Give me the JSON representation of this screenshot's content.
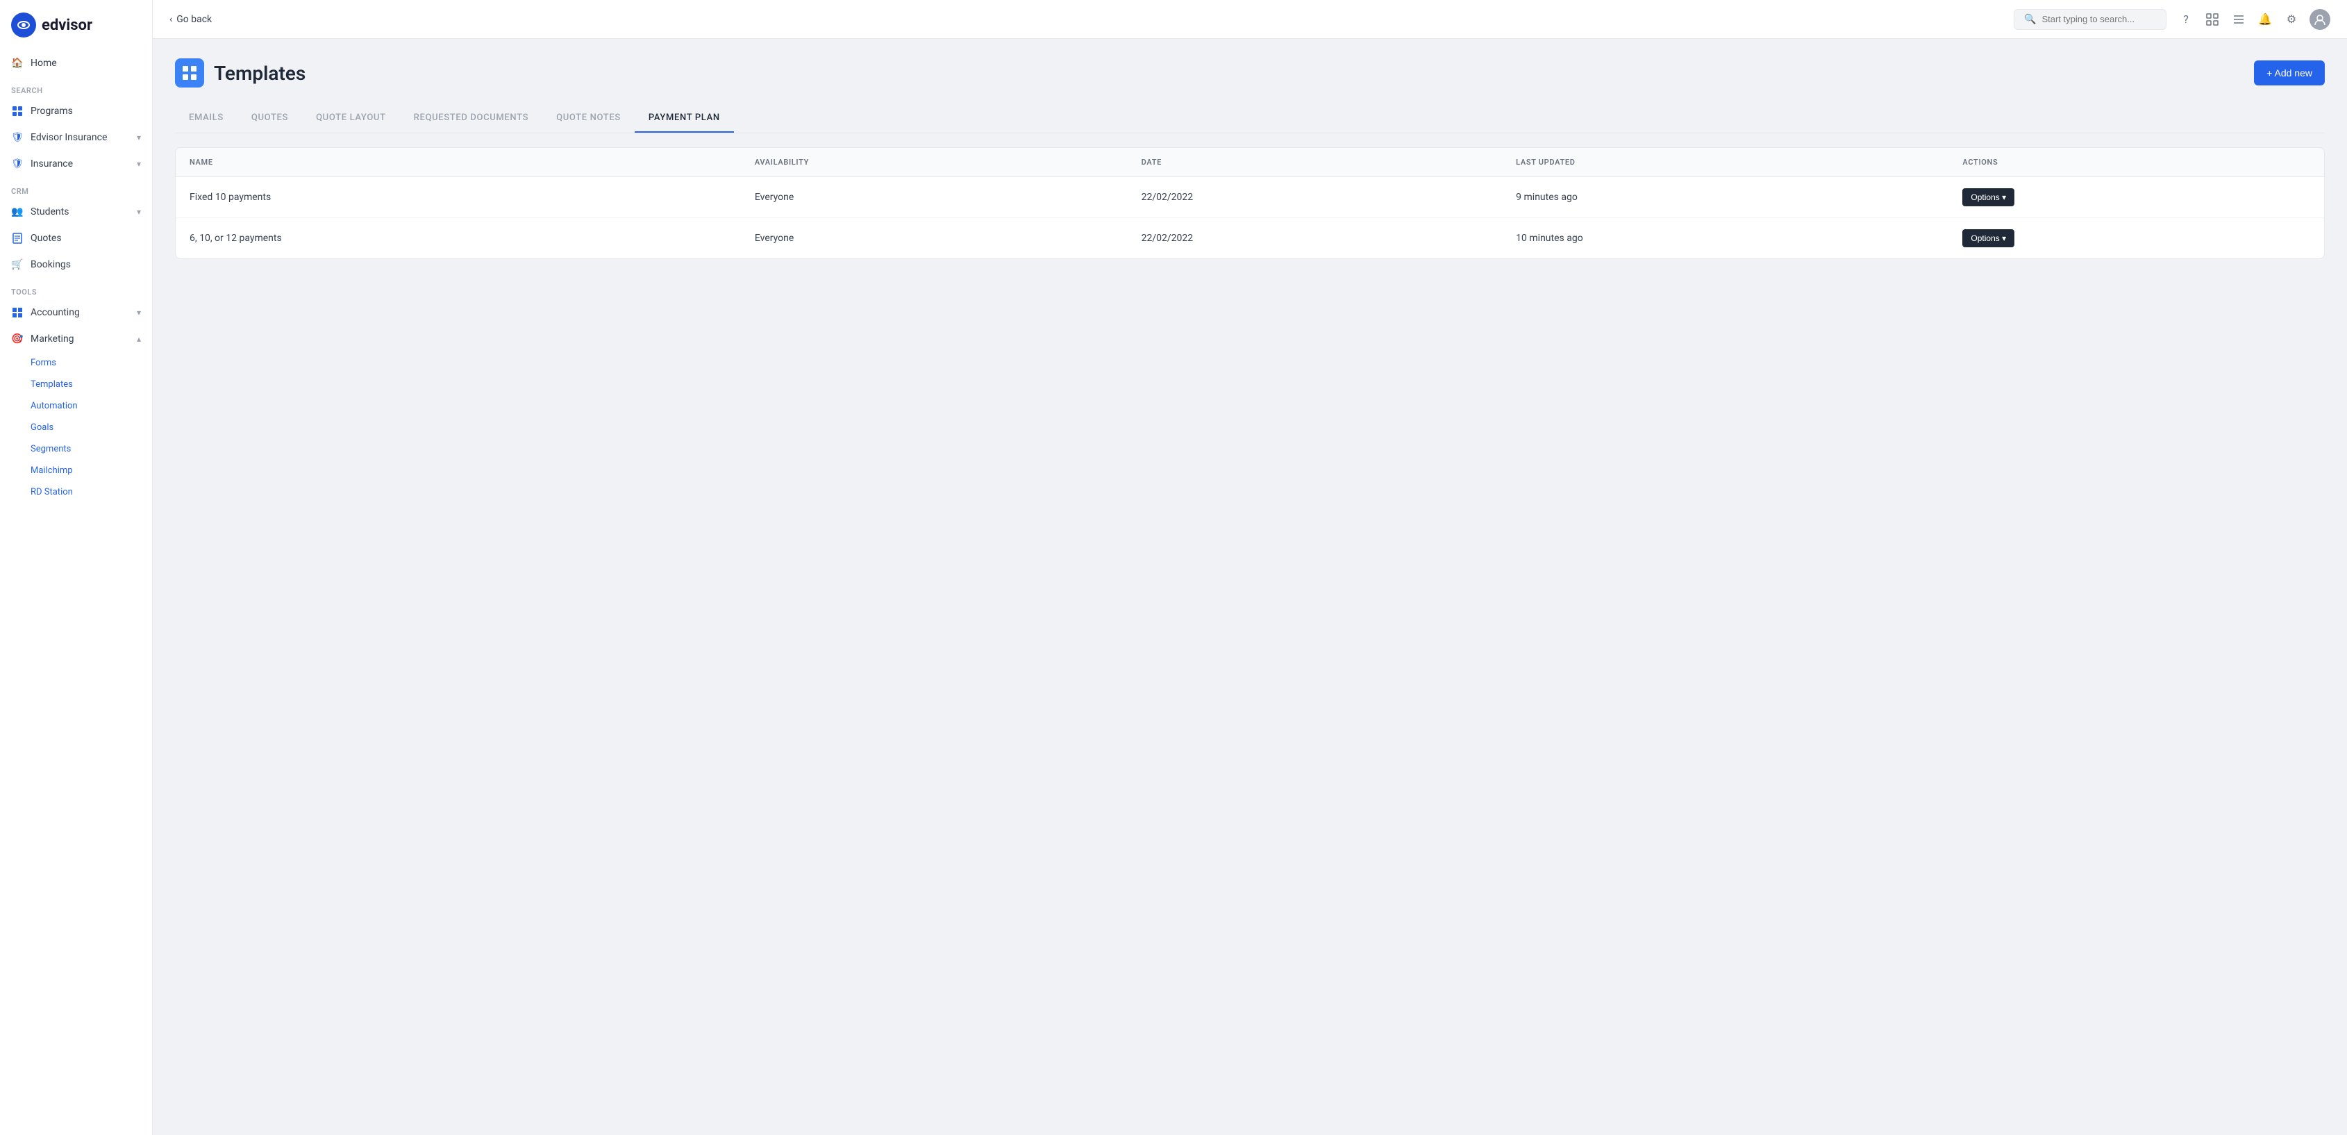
{
  "logo": {
    "text": "edvisor"
  },
  "sidebar": {
    "home_label": "Home",
    "search_section": "SEARCH",
    "crm_section": "CRM",
    "tools_section": "TOOLS",
    "nav_items": [
      {
        "id": "programs",
        "label": "Programs",
        "icon": "🗂"
      },
      {
        "id": "edvisor-insurance",
        "label": "Edvisor Insurance",
        "icon": "🛡",
        "has_chevron": true
      },
      {
        "id": "insurance",
        "label": "Insurance",
        "icon": "🛡",
        "has_chevron": true
      },
      {
        "id": "students",
        "label": "Students",
        "icon": "👥",
        "has_chevron": true
      },
      {
        "id": "quotes",
        "label": "Quotes",
        "icon": "📄"
      },
      {
        "id": "bookings",
        "label": "Bookings",
        "icon": "🛒"
      },
      {
        "id": "accounting",
        "label": "Accounting",
        "icon": "📊",
        "has_chevron": true
      },
      {
        "id": "marketing",
        "label": "Marketing",
        "icon": "🎯",
        "has_chevron": true,
        "expanded": true
      }
    ],
    "marketing_sub_items": [
      {
        "id": "forms",
        "label": "Forms"
      },
      {
        "id": "templates",
        "label": "Templates"
      },
      {
        "id": "automation",
        "label": "Automation"
      },
      {
        "id": "goals",
        "label": "Goals"
      },
      {
        "id": "segments",
        "label": "Segments"
      },
      {
        "id": "mailchimp",
        "label": "Mailchimp"
      },
      {
        "id": "rd-station",
        "label": "RD Station"
      }
    ]
  },
  "topbar": {
    "go_back_label": "Go back",
    "search_placeholder": "Start typing to search..."
  },
  "page": {
    "title": "Templates",
    "add_new_label": "+ Add new"
  },
  "tabs": [
    {
      "id": "emails",
      "label": "EMAILS"
    },
    {
      "id": "quotes",
      "label": "QUOTES"
    },
    {
      "id": "quote-layout",
      "label": "QUOTE LAYOUT"
    },
    {
      "id": "requested-documents",
      "label": "REQUESTED DOCUMENTS"
    },
    {
      "id": "quote-notes",
      "label": "QUOTE NOTES"
    },
    {
      "id": "payment-plan",
      "label": "PAYMENT PLAN",
      "active": true
    }
  ],
  "table": {
    "columns": [
      {
        "id": "name",
        "label": "NAME"
      },
      {
        "id": "availability",
        "label": "AVAILABILITY"
      },
      {
        "id": "date",
        "label": "DATE"
      },
      {
        "id": "last-updated",
        "label": "LAST UPDATED"
      },
      {
        "id": "actions",
        "label": "ACTIONS"
      }
    ],
    "rows": [
      {
        "name": "Fixed 10 payments",
        "availability": "Everyone",
        "date": "22/02/2022",
        "last_updated": "9 minutes ago",
        "options_label": "Options ▾"
      },
      {
        "name": "6, 10, or 12 payments",
        "availability": "Everyone",
        "date": "22/02/2022",
        "last_updated": "10 minutes ago",
        "options_label": "Options ▾"
      }
    ]
  }
}
